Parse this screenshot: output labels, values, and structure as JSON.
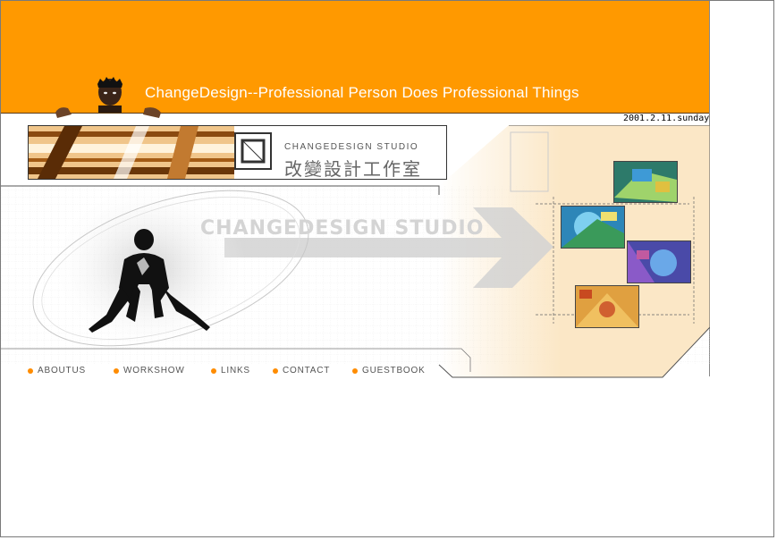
{
  "header": {
    "tagline": "ChangeDesign--Professional Person Does Professional Things",
    "date": "2001.2.11.sunday"
  },
  "logo": {
    "studio_en": "CHANGEDESIGN STUDIO",
    "studio_cn": "改變設計工作室"
  },
  "hero": {
    "title": "CHANGEDESIGN STUDIO"
  },
  "nav": {
    "items": [
      {
        "label": "ABOUTUS"
      },
      {
        "label": "WORKSHOW"
      },
      {
        "label": "LINKS"
      },
      {
        "label": "CONTACT"
      },
      {
        "label": "GUESTBOOK"
      }
    ]
  },
  "colors": {
    "accent": "#ff9900",
    "panel": "#fbe7c6",
    "nav_dot": "#ff8c00"
  }
}
